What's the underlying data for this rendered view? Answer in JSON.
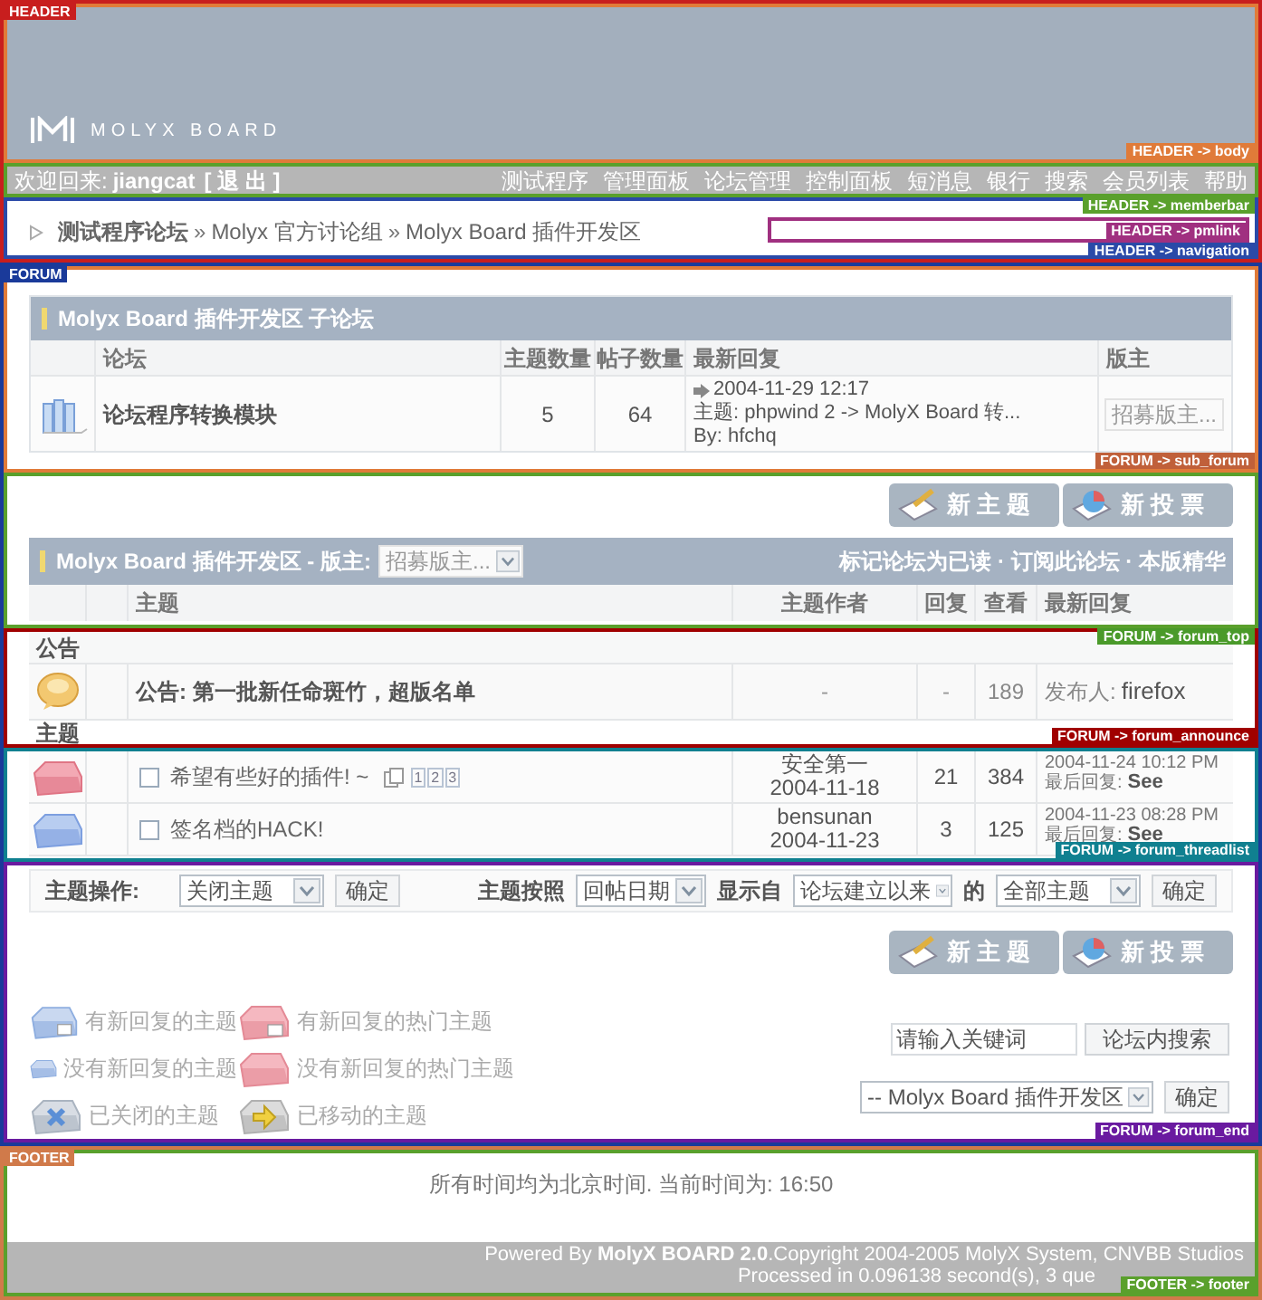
{
  "header": {
    "tag": "HEADER",
    "body": {
      "tag": "HEADER -> body",
      "logo_text": "MOLYX BOARD"
    },
    "memberbar": {
      "tag": "HEADER -> memberbar",
      "welcome": "欢迎回来:",
      "username": "jiangcat",
      "logout": "[ 退 出 ]",
      "links": [
        "测试程序",
        "管理面板",
        "论坛管理",
        "控制面板",
        "短消息",
        "银行",
        "搜索",
        "会员列表",
        "帮助"
      ]
    },
    "navigation": {
      "tag": "HEADER -> navigation",
      "crumbs": [
        "测试程序论坛",
        "Molyx 官方讨论组",
        "Molyx Board 插件开发区"
      ],
      "separator": "»",
      "pmlink": {
        "tag": "HEADER -> pmlink"
      }
    }
  },
  "forum": {
    "tag": "FORUM",
    "sub_forum": {
      "tag": "FORUM -> sub_forum",
      "title": "Molyx Board 插件开发区 子论坛",
      "columns": [
        "论坛",
        "主题数量",
        "帖子数量",
        "最新回复",
        "版主"
      ],
      "rows": [
        {
          "name": "论坛程序转换模块",
          "topics": "5",
          "posts": "64",
          "last_date": "2004-11-29 12:17",
          "last_subject": "主题: phpwind 2 -> MolyX Board 转...",
          "last_by": "By: hfchq",
          "moderator": {
            "value": "招募版主...",
            "disabled": true
          }
        }
      ]
    },
    "forum_top": {
      "tag": "FORUM -> forum_top",
      "buttons": [
        {
          "kind": "topic",
          "label": "新 主 题"
        },
        {
          "kind": "poll",
          "label": "新 投 票"
        }
      ],
      "title": "Molyx Board 插件开发区 - 版主:",
      "moderator": {
        "value": "招募版主...",
        "disabled": true
      },
      "actions": "标记论坛为已读 · 订阅此论坛 · 本版精华",
      "columns": [
        "主题",
        "主题作者",
        "回复",
        "查看",
        "最新回复"
      ]
    },
    "forum_announce": {
      "tag": "FORUM -> forum_announce",
      "heading": "公告",
      "row": {
        "title": "公告: 第一批新任命斑竹，超版名单",
        "author": "-",
        "replies": "-",
        "views": "189",
        "poster_label": "发布人:",
        "poster": "firefox"
      },
      "threads_heading": "主题"
    },
    "forum_threadlist": {
      "tag": "FORUM -> forum_threadlist",
      "rows": [
        {
          "kind": "hot",
          "checked": false,
          "title": "希望有些好的插件! ~",
          "pages": [
            "1",
            "2",
            "3"
          ],
          "author": "安全第一",
          "date": "2004-11-18",
          "replies": "21",
          "views": "384",
          "last_date": "2004-11-24 10:12 PM",
          "last_label": "最后回复:",
          "last_by": "See"
        },
        {
          "kind": "normal",
          "checked": false,
          "title": "签名档的HACK!",
          "pages": [],
          "author": "bensunan",
          "date": "2004-11-23",
          "replies": "3",
          "views": "125",
          "last_date": "2004-11-23 08:28 PM",
          "last_label": "最后回复:",
          "last_by": "See"
        }
      ]
    },
    "forum_end": {
      "tag": "FORUM -> forum_end",
      "topic_ops_label": "主题操作:",
      "topic_op": "关闭主题",
      "confirm": "确定",
      "sort_label": "主题按照",
      "sort": "回帖日期",
      "show_from_label": "显示自",
      "show_from": "论坛建立以来",
      "of_label": "的",
      "scope": "全部主题",
      "confirm_filter": "确定",
      "buttons": [
        {
          "kind": "topic",
          "label": "新 主 题"
        },
        {
          "kind": "poll",
          "label": "新 投 票"
        }
      ],
      "legend": [
        {
          "kind": "new",
          "label": "有新回复的主题"
        },
        {
          "kind": "hot_new",
          "label": "有新回复的热门主题"
        },
        {
          "kind": "no_new",
          "label": "没有新回复的主题"
        },
        {
          "kind": "hot_no_new",
          "label": "没有新回复的热门主题"
        },
        {
          "kind": "closed",
          "label": "已关闭的主题"
        },
        {
          "kind": "moved",
          "label": "已移动的主题"
        }
      ],
      "search": {
        "value": "请输入关键词",
        "button": "论坛内搜索"
      },
      "jump": {
        "value": "-- Molyx Board 插件开发区",
        "button": "确定"
      }
    }
  },
  "footer": {
    "tag": "FOOTER",
    "inner_tag": "FOOTER -> footer",
    "time_note": "所有时间均为北京时间. 当前时间为: 16:50",
    "powered": "Powered By **MolyX BOARD 2.0**.Copyright 2004-2005 MolyX System, CNVBB Studios",
    "processed": "Processed in 0.096138 second(s), 3 que"
  }
}
